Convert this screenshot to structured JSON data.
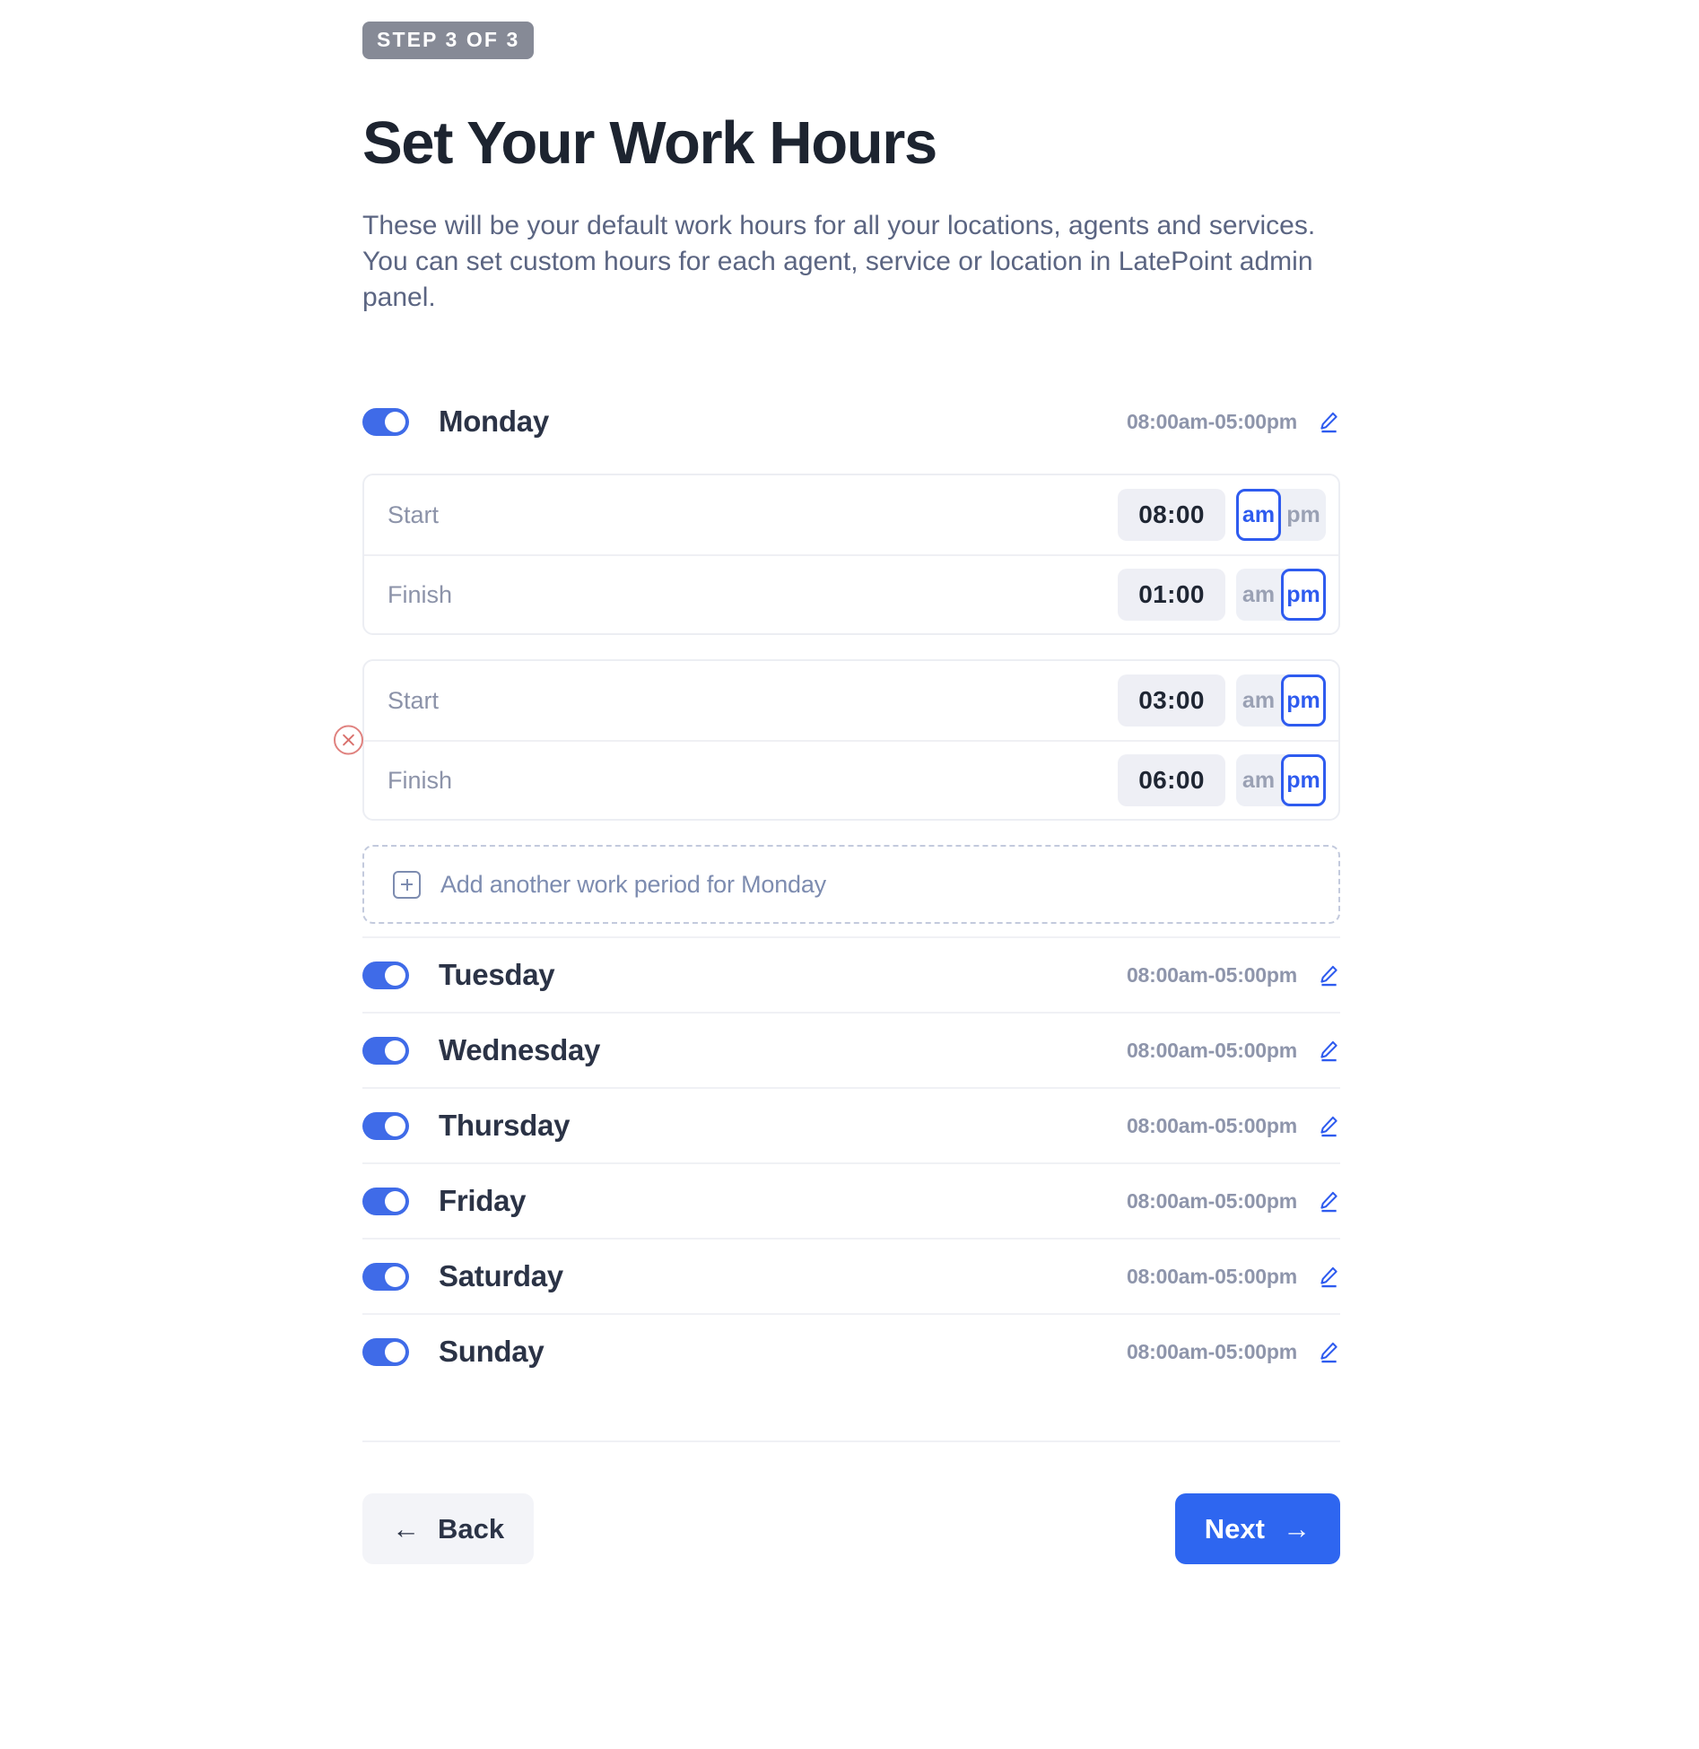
{
  "step_badge": "STEP 3 OF 3",
  "title": "Set Your Work Hours",
  "subtitle": "These will be your default work hours for all your locations, agents and services. You can set custom hours for each agent, service or location in LatePoint admin panel.",
  "colors": {
    "accent": "#2e66f0",
    "toggle_on": "#3f6be8",
    "badge_bg": "#868a96",
    "muted_text": "#8e95ab",
    "remove_border": "#e0827f",
    "dashed_border": "#c3cadd"
  },
  "icons": {
    "edit": "edit-pencil-icon",
    "add": "plus-square-icon",
    "remove": "close-circle-icon",
    "back_arrow": "arrow-left-icon",
    "next_arrow": "arrow-right-icon"
  },
  "days": [
    {
      "name": "Monday",
      "enabled": true,
      "hours_summary": "08:00am-05:00pm",
      "expanded": true,
      "periods": [
        {
          "removable": false,
          "start": {
            "label": "Start",
            "time": "08:00",
            "meridiem": "am",
            "options": [
              "am",
              "pm"
            ]
          },
          "finish": {
            "label": "Finish",
            "time": "01:00",
            "meridiem": "pm",
            "options": [
              "am",
              "pm"
            ]
          }
        },
        {
          "removable": true,
          "start": {
            "label": "Start",
            "time": "03:00",
            "meridiem": "pm",
            "options": [
              "am",
              "pm"
            ]
          },
          "finish": {
            "label": "Finish",
            "time": "06:00",
            "meridiem": "pm",
            "options": [
              "am",
              "pm"
            ]
          }
        }
      ],
      "add_period_label": "Add another work period for Monday"
    },
    {
      "name": "Tuesday",
      "enabled": true,
      "hours_summary": "08:00am-05:00pm",
      "expanded": false
    },
    {
      "name": "Wednesday",
      "enabled": true,
      "hours_summary": "08:00am-05:00pm",
      "expanded": false
    },
    {
      "name": "Thursday",
      "enabled": true,
      "hours_summary": "08:00am-05:00pm",
      "expanded": false
    },
    {
      "name": "Friday",
      "enabled": true,
      "hours_summary": "08:00am-05:00pm",
      "expanded": false
    },
    {
      "name": "Saturday",
      "enabled": true,
      "hours_summary": "08:00am-05:00pm",
      "expanded": false
    },
    {
      "name": "Sunday",
      "enabled": true,
      "hours_summary": "08:00am-05:00pm",
      "expanded": false
    }
  ],
  "footer": {
    "back_label": "Back",
    "next_label": "Next",
    "back_arrow_glyph": "←",
    "next_arrow_glyph": "→"
  }
}
